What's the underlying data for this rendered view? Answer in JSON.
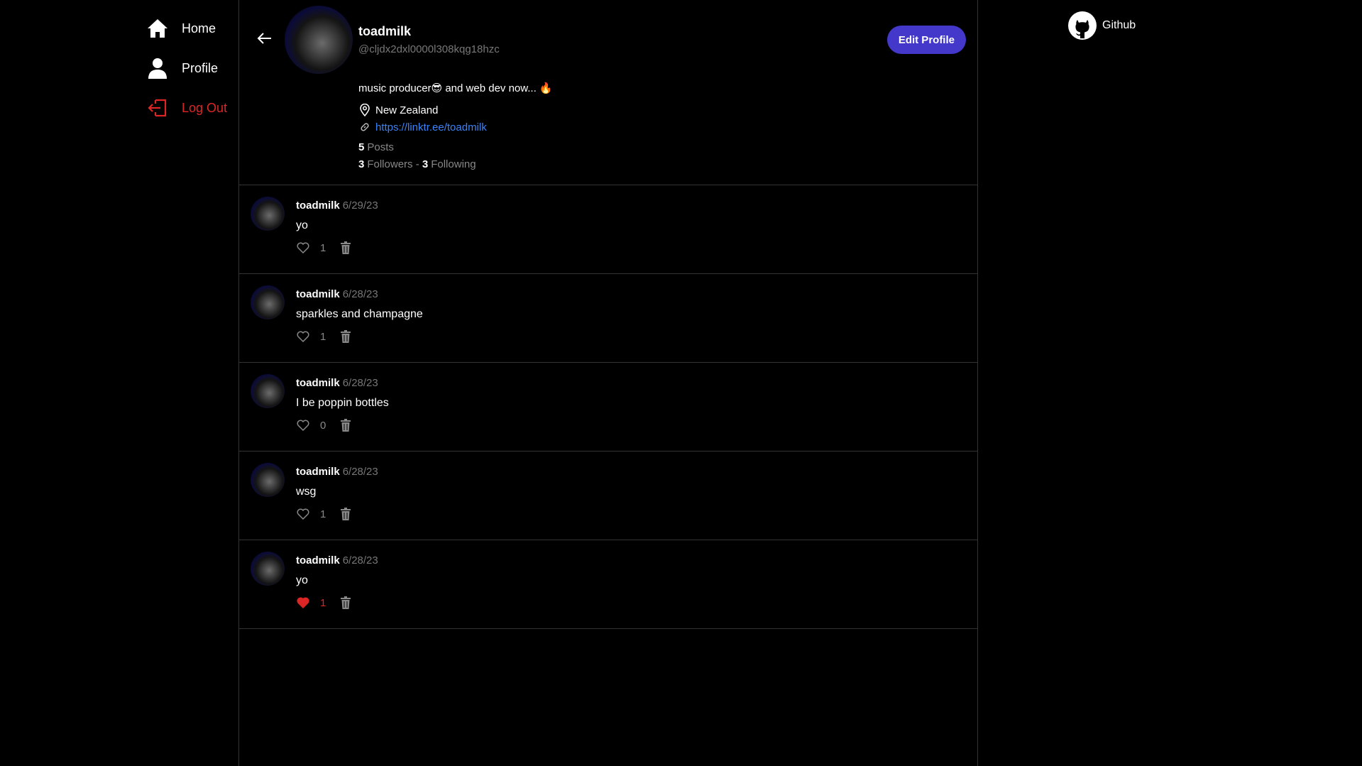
{
  "nav": {
    "home": "Home",
    "profile": "Profile",
    "logout": "Log Out"
  },
  "profile": {
    "name": "toadmilk",
    "handle": "@cljdx2dxl0000l308kqg18hzc",
    "edit_label": "Edit Profile",
    "bio": "music producer😎 and web dev now... 🔥",
    "location": "New Zealand",
    "link": "https://linktr.ee/toadmilk",
    "posts_count": "5",
    "posts_label": "Posts",
    "followers_count": "3",
    "followers_label": "Followers",
    "separator": "-",
    "following_count": "3",
    "following_label": "Following"
  },
  "posts": [
    {
      "author": "toadmilk",
      "date": "6/29/23",
      "text": "yo",
      "likes": "1",
      "liked": false
    },
    {
      "author": "toadmilk",
      "date": "6/28/23",
      "text": "sparkles and champagne",
      "likes": "1",
      "liked": false
    },
    {
      "author": "toadmilk",
      "date": "6/28/23",
      "text": "I be poppin bottles",
      "likes": "0",
      "liked": false
    },
    {
      "author": "toadmilk",
      "date": "6/28/23",
      "text": "wsg",
      "likes": "1",
      "liked": false
    },
    {
      "author": "toadmilk",
      "date": "6/28/23",
      "text": "yo",
      "likes": "1",
      "liked": true
    }
  ],
  "external": {
    "github_label": "Github"
  },
  "colors": {
    "accent": "#4338ca",
    "danger": "#dc2626",
    "link": "#3b82f6",
    "muted": "#777777"
  }
}
